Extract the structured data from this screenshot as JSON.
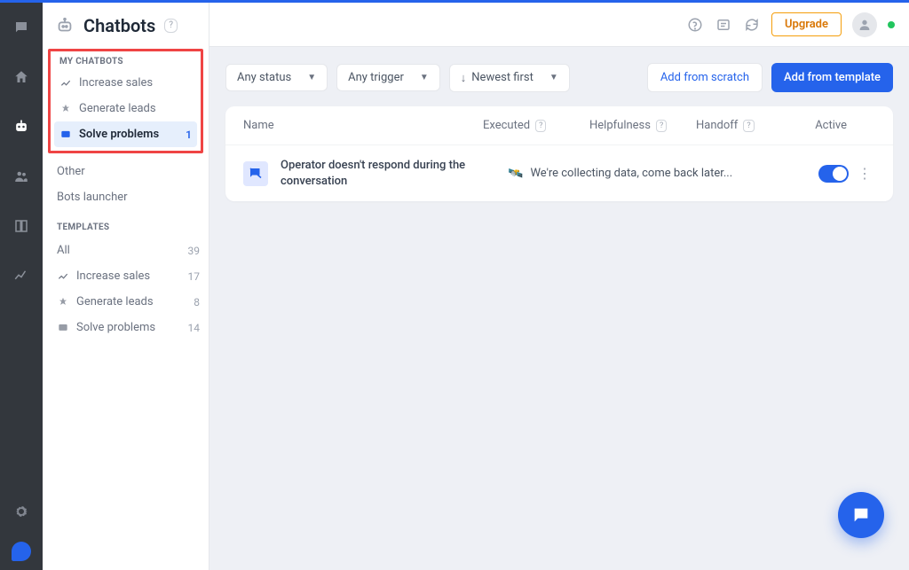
{
  "page": {
    "title": "Chatbots"
  },
  "header": {
    "upgrade": "Upgrade"
  },
  "sidebar": {
    "my_chatbots_label": "MY CHATBOTS",
    "templates_label": "TEMPLATES",
    "items": [
      {
        "label": "Increase sales"
      },
      {
        "label": "Generate leads"
      },
      {
        "label": "Solve problems",
        "count": "1"
      },
      {
        "label": "Other"
      },
      {
        "label": "Bots launcher"
      }
    ],
    "templates": [
      {
        "label": "All",
        "count": "39"
      },
      {
        "label": "Increase sales",
        "count": "17"
      },
      {
        "label": "Generate leads",
        "count": "8"
      },
      {
        "label": "Solve problems",
        "count": "14"
      }
    ]
  },
  "filters": {
    "status": "Any status",
    "trigger": "Any trigger",
    "sort": "Newest first"
  },
  "actions": {
    "add_scratch": "Add from scratch",
    "add_template": "Add from template"
  },
  "table": {
    "headers": {
      "name": "Name",
      "executed": "Executed",
      "helpfulness": "Helpfulness",
      "handoff": "Handoff",
      "active": "Active"
    },
    "rows": [
      {
        "name": "Operator doesn't respond during the conversation",
        "collecting": "We're collecting data, come back later...",
        "active": true
      }
    ]
  }
}
